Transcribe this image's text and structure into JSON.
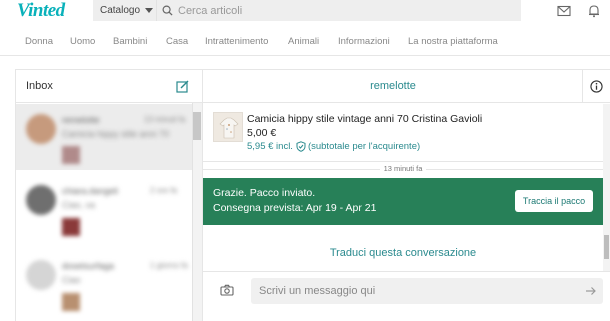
{
  "header": {
    "logo": "Vinted",
    "catalog_label": "Catalogo",
    "search_placeholder": "Cerca articoli"
  },
  "categories": [
    "Donna",
    "Uomo",
    "Bambini",
    "Casa",
    "Intrattenimento",
    "Animali",
    "Informazioni",
    "La nostra piattaforma"
  ],
  "inbox": {
    "title": "Inbox",
    "conversations": [
      {
        "name": "remelotte",
        "time": "13 minuti fa",
        "preview": "Camicia hippy stile anni 70"
      },
      {
        "name": "chiara.dangeli",
        "time": "2 ore fa",
        "preview": "Ciao, va"
      },
      {
        "name": "dosetsurfaga",
        "time": "1 giorno fa",
        "preview": "Ciao"
      }
    ]
  },
  "conversation": {
    "username": "remelotte",
    "item": {
      "title": "Camicia hippy stile vintage anni 70 Cristina Gavioli",
      "price": "5,00 €",
      "total_price": "5,95 € incl.",
      "protection": "(subtotale per l'acquirente)"
    },
    "timestamp": "13 minuti fa",
    "banner": {
      "line1": "Grazie. Pacco inviato.",
      "line2": "Consegna prevista: Apr 19 - Apr 21",
      "button": "Traccia il pacco"
    },
    "translate_link": "Traduci questa conversazione",
    "composer_placeholder": "Scrivi un messaggio qui"
  },
  "colors": {
    "brand": "#09b1ba",
    "link": "#2a8a8e",
    "banner": "#278058"
  }
}
